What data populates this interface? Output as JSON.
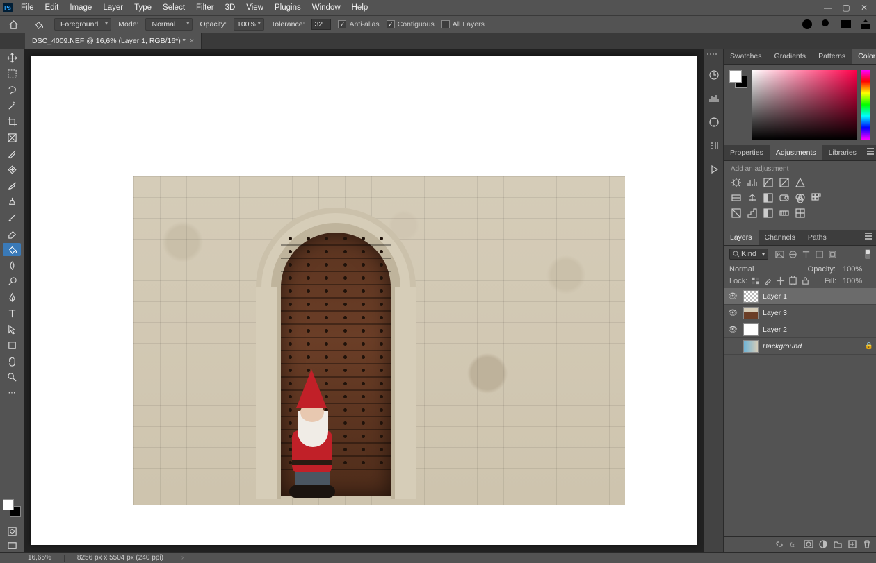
{
  "menu": [
    "File",
    "Edit",
    "Image",
    "Layer",
    "Type",
    "Select",
    "Filter",
    "3D",
    "View",
    "Plugins",
    "Window",
    "Help"
  ],
  "optbar": {
    "fillmode": "Foreground",
    "mode_label": "Mode:",
    "mode_value": "Normal",
    "opacity_label": "Opacity:",
    "opacity_value": "100%",
    "tolerance_label": "Tolerance:",
    "tolerance_value": "32",
    "antialias": "Anti-alias",
    "contiguous": "Contiguous",
    "alllayers": "All Layers"
  },
  "doc": {
    "tab": "DSC_4009.NEF @ 16,6% (Layer 1, RGB/16*) *"
  },
  "panel_color": {
    "tabs": [
      "Swatches",
      "Gradients",
      "Patterns",
      "Color"
    ],
    "active": 3
  },
  "panel_adjust": {
    "tabs": [
      "Properties",
      "Adjustments",
      "Libraries"
    ],
    "active": 1,
    "hint": "Add an adjustment"
  },
  "panel_layers": {
    "tabs": [
      "Layers",
      "Channels",
      "Paths"
    ],
    "active": 0,
    "kind_label": "Kind",
    "blend_mode": "Normal",
    "opacity_label": "Opacity:",
    "opacity_value": "100%",
    "lock_label": "Lock:",
    "fill_label": "Fill:",
    "fill_value": "100%",
    "layers": [
      {
        "visible": true,
        "name": "Layer 1",
        "active": true,
        "thumb": "checker",
        "italic": false
      },
      {
        "visible": true,
        "name": "Layer 3",
        "active": false,
        "thumb": "door",
        "italic": false
      },
      {
        "visible": true,
        "name": "Layer 2",
        "active": false,
        "thumb": "white",
        "italic": false
      },
      {
        "visible": false,
        "name": "Background",
        "active": false,
        "thumb": "bg",
        "italic": true,
        "locked": true
      }
    ]
  },
  "status": {
    "zoom": "16,65%",
    "dims": "8256 px x 5504 px (240 ppi)"
  }
}
